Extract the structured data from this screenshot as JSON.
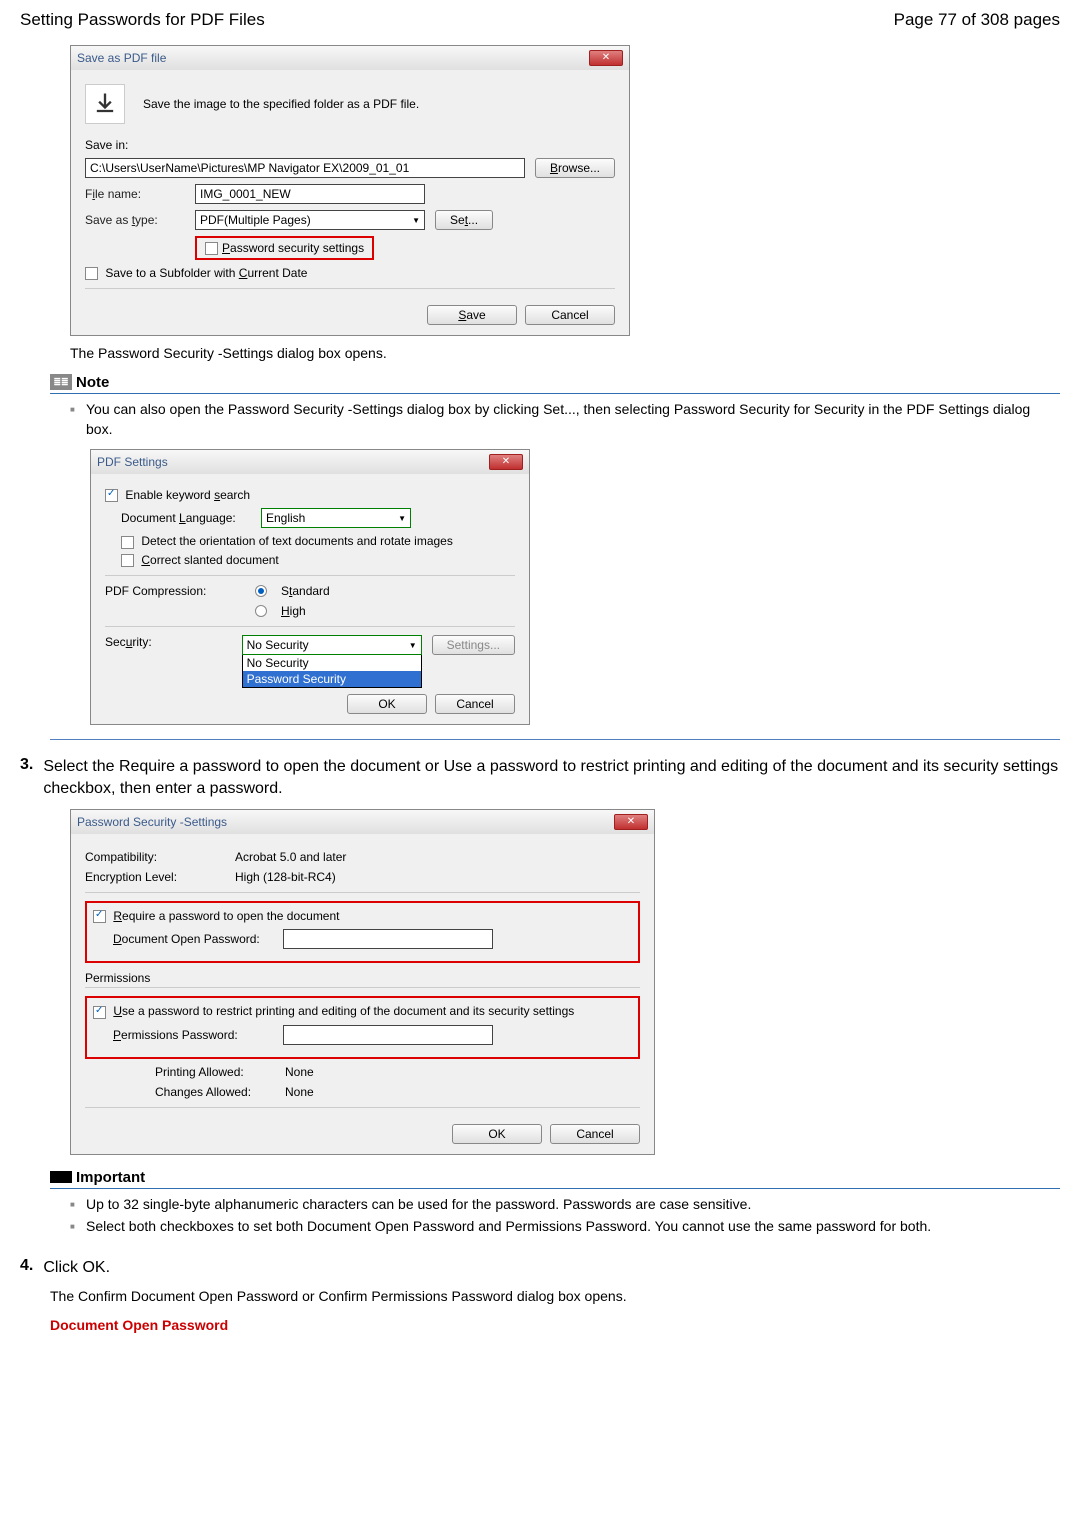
{
  "header": {
    "title": "Setting Passwords for PDF Files",
    "page": "Page 77 of 308 pages"
  },
  "save_dialog": {
    "title": "Save as PDF file",
    "instruction": "Save the image to the specified folder as a PDF file.",
    "save_in_label": "Save in:",
    "path": "C:\\Users\\UserName\\Pictures\\MP Navigator EX\\2009_01_01",
    "browse": "Browse...",
    "filename_label": "File name:",
    "filename": "IMG_0001_NEW",
    "type_label": "Save as type:",
    "type": "PDF(Multiple Pages)",
    "set": "Set...",
    "pw_security": "Password security settings",
    "subfolder": "Save to a Subfolder with Current Date",
    "save": "Save",
    "cancel": "Cancel"
  },
  "text1": "The Password Security -Settings dialog box opens.",
  "note": {
    "head": "Note",
    "item1": "You can also open the Password Security -Settings dialog box by clicking Set..., then selecting Password Security for Security in the PDF Settings dialog box."
  },
  "pdfset": {
    "title": "PDF Settings",
    "enable_kw": "Enable keyword search",
    "doclang_label": "Document Language:",
    "doclang": "English",
    "detect": "Detect the orientation of text documents and rotate images",
    "correct": "Correct slanted document",
    "comp_label": "PDF Compression:",
    "standard": "Standard",
    "high": "High",
    "security_label": "Security:",
    "security_val": "No Security",
    "opt1": "No Security",
    "opt2": "Password Security",
    "settings_btn": "Settings...",
    "ok": "OK",
    "cancel": "Cancel"
  },
  "step3": {
    "num": "3.",
    "txt": "Select the Require a password to open the document or Use a password to restrict printing and editing of the document and its security settings checkbox, then enter a password."
  },
  "pwset": {
    "title": "Password Security -Settings",
    "compat_label": "Compatibility:",
    "compat": "Acrobat 5.0 and later",
    "enc_label": "Encryption Level:",
    "enc": "High (128-bit-RC4)",
    "req_pw": "Require a password to open the document",
    "doc_open_label": "Document Open Password:",
    "perm_head": "Permissions",
    "use_pw": "Use a password to restrict printing and editing of the document and its security settings",
    "perm_pw_label": "Permissions Password:",
    "print_label": "Printing Allowed:",
    "print_val": "None",
    "changes_label": "Changes Allowed:",
    "changes_val": "None",
    "ok": "OK",
    "cancel": "Cancel"
  },
  "important": {
    "head": "Important",
    "item1": "Up to 32 single-byte alphanumeric characters can be used for the password. Passwords are case sensitive.",
    "item2": "Select both checkboxes to set both Document Open Password and Permissions Password. You cannot use the same password for both."
  },
  "step4": {
    "num": "4.",
    "txt": "Click OK."
  },
  "text4": "The Confirm Document Open Password or Confirm Permissions Password dialog box opens.",
  "heading_dop": "Document Open Password"
}
